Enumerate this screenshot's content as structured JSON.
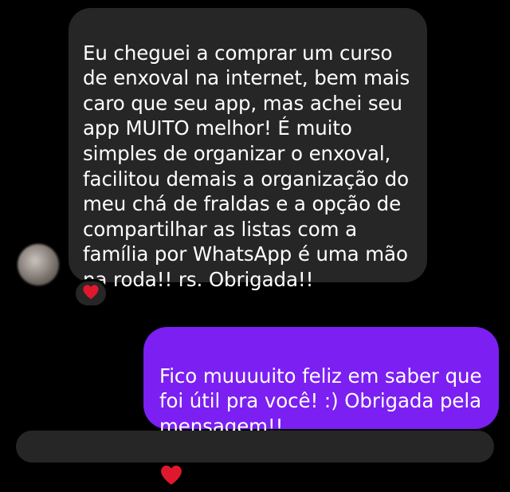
{
  "conversation": {
    "incoming_message": "Eu cheguei a comprar um curso\nde enxoval na internet, bem mais\ncaro que seu app, mas achei seu\napp MUITO melhor! É muito\nsimples de organizar o enxoval,\nfacilitou demais a organização do\nmeu chá de fraldas e a opção de\ncompartilhar as listas com a\nfamília por WhatsApp é uma mão\nna roda!! rs. Obrigada!!",
    "reaction_icon": "red-heart-icon",
    "outgoing_message": "Fico muuuuito feliz em saber que\nfoi útil pra você! :) Obrigada pela\nmensagem!!",
    "outgoing_emoji_icon": "red-heart-icon"
  },
  "colors": {
    "background": "#000000",
    "incoming_bubble": "#262626",
    "outgoing_bubble": "#7b1ff2",
    "heart": "#e0182d",
    "text": "#ffffff"
  }
}
